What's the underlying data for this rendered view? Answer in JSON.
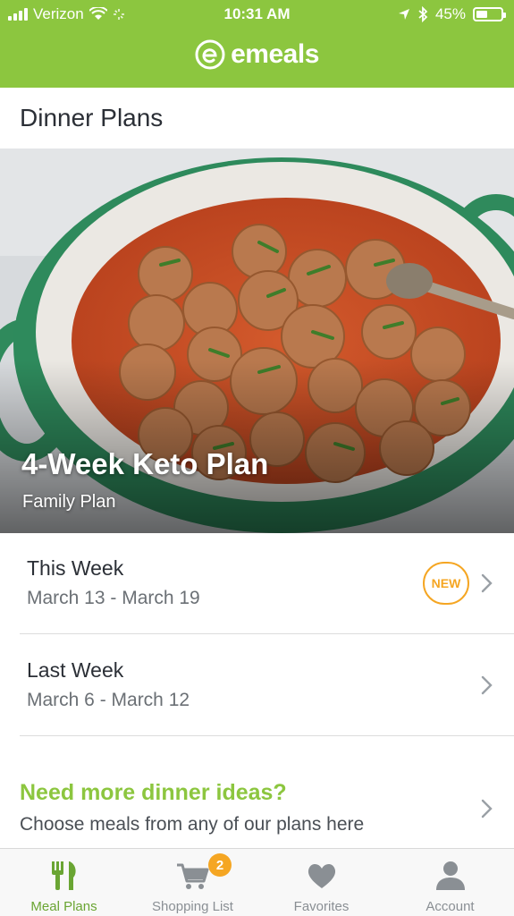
{
  "status_bar": {
    "carrier": "Verizon",
    "time": "10:31 AM",
    "battery": "45%",
    "battery_level": 0.45
  },
  "app": {
    "brand": "emeals"
  },
  "page": {
    "title": "Dinner Plans"
  },
  "hero": {
    "title": "4-Week Keto Plan",
    "subtitle": "Family Plan"
  },
  "weeks": [
    {
      "title": "This Week",
      "dates": "March 13 - March 19",
      "badge": "NEW"
    },
    {
      "title": "Last Week",
      "dates": "March 6 - March 12"
    }
  ],
  "more": {
    "title": "Need more dinner ideas?",
    "description": "Choose meals from any of our plans here"
  },
  "tabs": [
    {
      "label": "Meal Plans",
      "icon": "utensils-icon",
      "active": true
    },
    {
      "label": "Shopping List",
      "icon": "cart-icon",
      "badge": "2"
    },
    {
      "label": "Favorites",
      "icon": "heart-icon"
    },
    {
      "label": "Account",
      "icon": "user-icon"
    }
  ],
  "colors": {
    "brand_green": "#8cc63f",
    "badge_orange": "#f5a623",
    "text_dark": "#2b2f36",
    "text_gray": "#6b7075"
  }
}
